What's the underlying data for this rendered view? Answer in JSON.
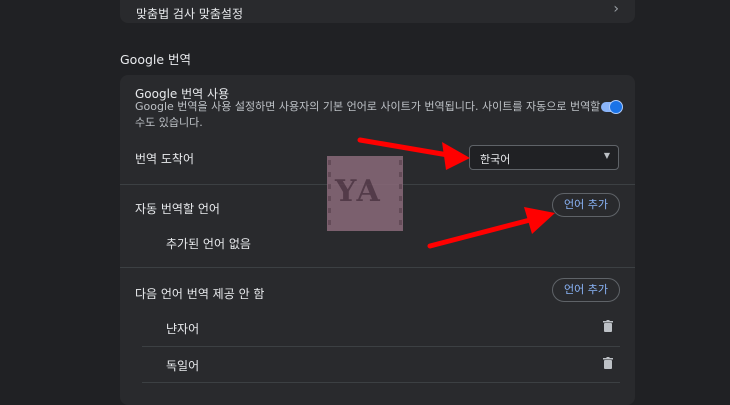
{
  "top_card": {
    "label": "맞춤법 검사 맞춤설정",
    "chevron": "›"
  },
  "section": {
    "title": "Google 번역"
  },
  "translate": {
    "use_title": "Google 번역 사용",
    "use_desc_line1": "Google 번역을 사용 설정하면 사용자의 기본 언어로 사이트가 번역됩니다. 사이트를 자동으로 번역할",
    "use_desc_line2": "수도 있습니다.",
    "toggle_on": true
  },
  "target": {
    "label": "번역 도착어",
    "selected": "한국어"
  },
  "auto": {
    "label": "자동 번역할 언어",
    "button": "언어 추가",
    "empty": "추가된 언어 없음"
  },
  "never": {
    "label": "다음 언어 번역 제공 안 함",
    "button": "언어 추가",
    "languages": [
      "냔자어",
      "독일어"
    ]
  },
  "watermark": {
    "text": "YA"
  },
  "colors": {
    "accent": "#8ab4f8",
    "background": "#202124",
    "card": "#292a2d",
    "arrow": "#ff0000"
  }
}
